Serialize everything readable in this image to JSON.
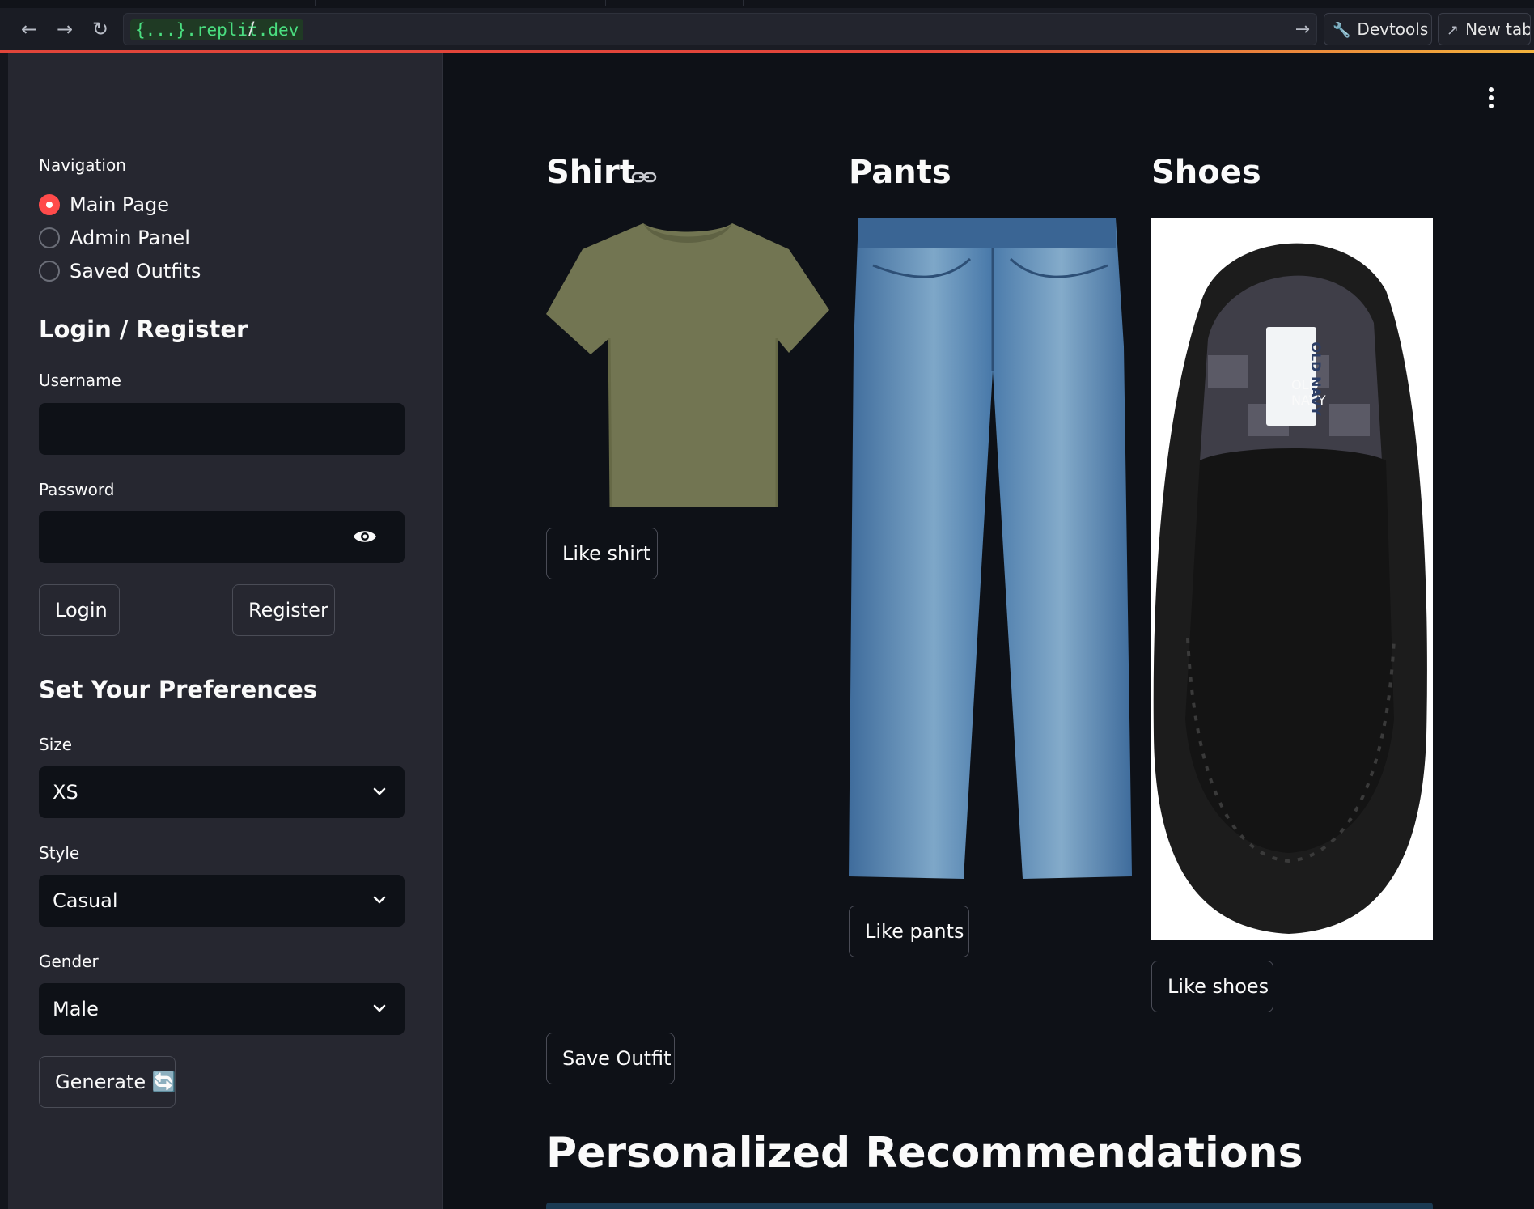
{
  "browser": {
    "url_host": "{...}.replit.dev",
    "url_path": "/",
    "devtools_label": "Devtools",
    "newtab_label": "New tab"
  },
  "sidebar": {
    "navigation_label": "Navigation",
    "nav_options": [
      {
        "label": "Main Page",
        "selected": true
      },
      {
        "label": "Admin Panel",
        "selected": false
      },
      {
        "label": "Saved Outfits",
        "selected": false
      }
    ],
    "login_heading": "Login / Register",
    "username_label": "Username",
    "username_value": "",
    "password_label": "Password",
    "password_value": "",
    "login_button": "Login",
    "register_button": "Register",
    "preferences_heading": "Set Your Preferences",
    "size_label": "Size",
    "size_value": "XS",
    "style_label": "Style",
    "style_value": "Casual",
    "gender_label": "Gender",
    "gender_value": "Male",
    "generate_button": "Generate 🔄"
  },
  "main": {
    "columns": [
      {
        "heading": "Shirt",
        "like_label": "Like shirt",
        "image": "olive-green-tshirt"
      },
      {
        "heading": "Pants",
        "like_label": "Like pants",
        "image": "blue-jeans"
      },
      {
        "heading": "Shoes",
        "like_label": "Like shoes",
        "image": "black-slip-on-shoe",
        "shoe_label_text": "OLD NAVY"
      }
    ],
    "save_outfit_button": "Save Outfit",
    "recommendations_heading": "Personalized Recommendations"
  },
  "colors": {
    "app_background": "#0e1117",
    "sidebar_background": "#262730",
    "accent_red": "#ff4b4b",
    "url_host_green": "#4ade80"
  }
}
